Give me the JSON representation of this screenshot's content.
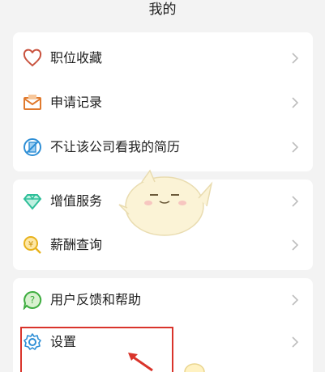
{
  "page": {
    "title": "我的"
  },
  "menu": {
    "favorites": "职位收藏",
    "applications": "申请记录",
    "block_company": "不让该公司看我的简历",
    "value_added": "增值服务",
    "salary_query": "薪酬查询",
    "feedback_help": "用户反馈和帮助",
    "settings": "设置"
  },
  "colors": {
    "heart": "#c9533f",
    "envelope": "#e07a2e",
    "block": "#2f8fd6",
    "diamond": "#2fbf9a",
    "coin": "#e8b21c",
    "feedback": "#3dad3f",
    "settings": "#2f8fd6",
    "highlight": "#d9342b"
  },
  "icons": {
    "favorites": "heart-icon",
    "applications": "envelope-icon",
    "block_company": "blocked-document-icon",
    "value_added": "diamond-icon",
    "salary_query": "coin-search-icon",
    "feedback_help": "question-bubble-icon",
    "settings": "gear-icon"
  }
}
